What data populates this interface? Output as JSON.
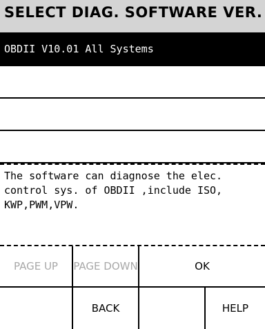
{
  "title": "SELECT DIAG. SOFTWARE VER.",
  "list": {
    "rows": [
      {
        "label": "OBDII V10.01 All Systems",
        "selected": true
      },
      {
        "label": "",
        "selected": false
      },
      {
        "label": "",
        "selected": false
      },
      {
        "label": "",
        "selected": false
      }
    ]
  },
  "description": "The software can diagnose the elec.\ncontrol sys. of OBDII ,include ISO,\nKWP,PWM,VPW.",
  "buttons": {
    "page_up": "PAGE UP",
    "page_down": "PAGE DOWN",
    "ok": "OK",
    "back": "BACK",
    "help": "HELP"
  },
  "colors": {
    "title_bg": "#d4d4d4",
    "selected_bg": "#000000",
    "disabled_text": "#a8a8a8"
  }
}
